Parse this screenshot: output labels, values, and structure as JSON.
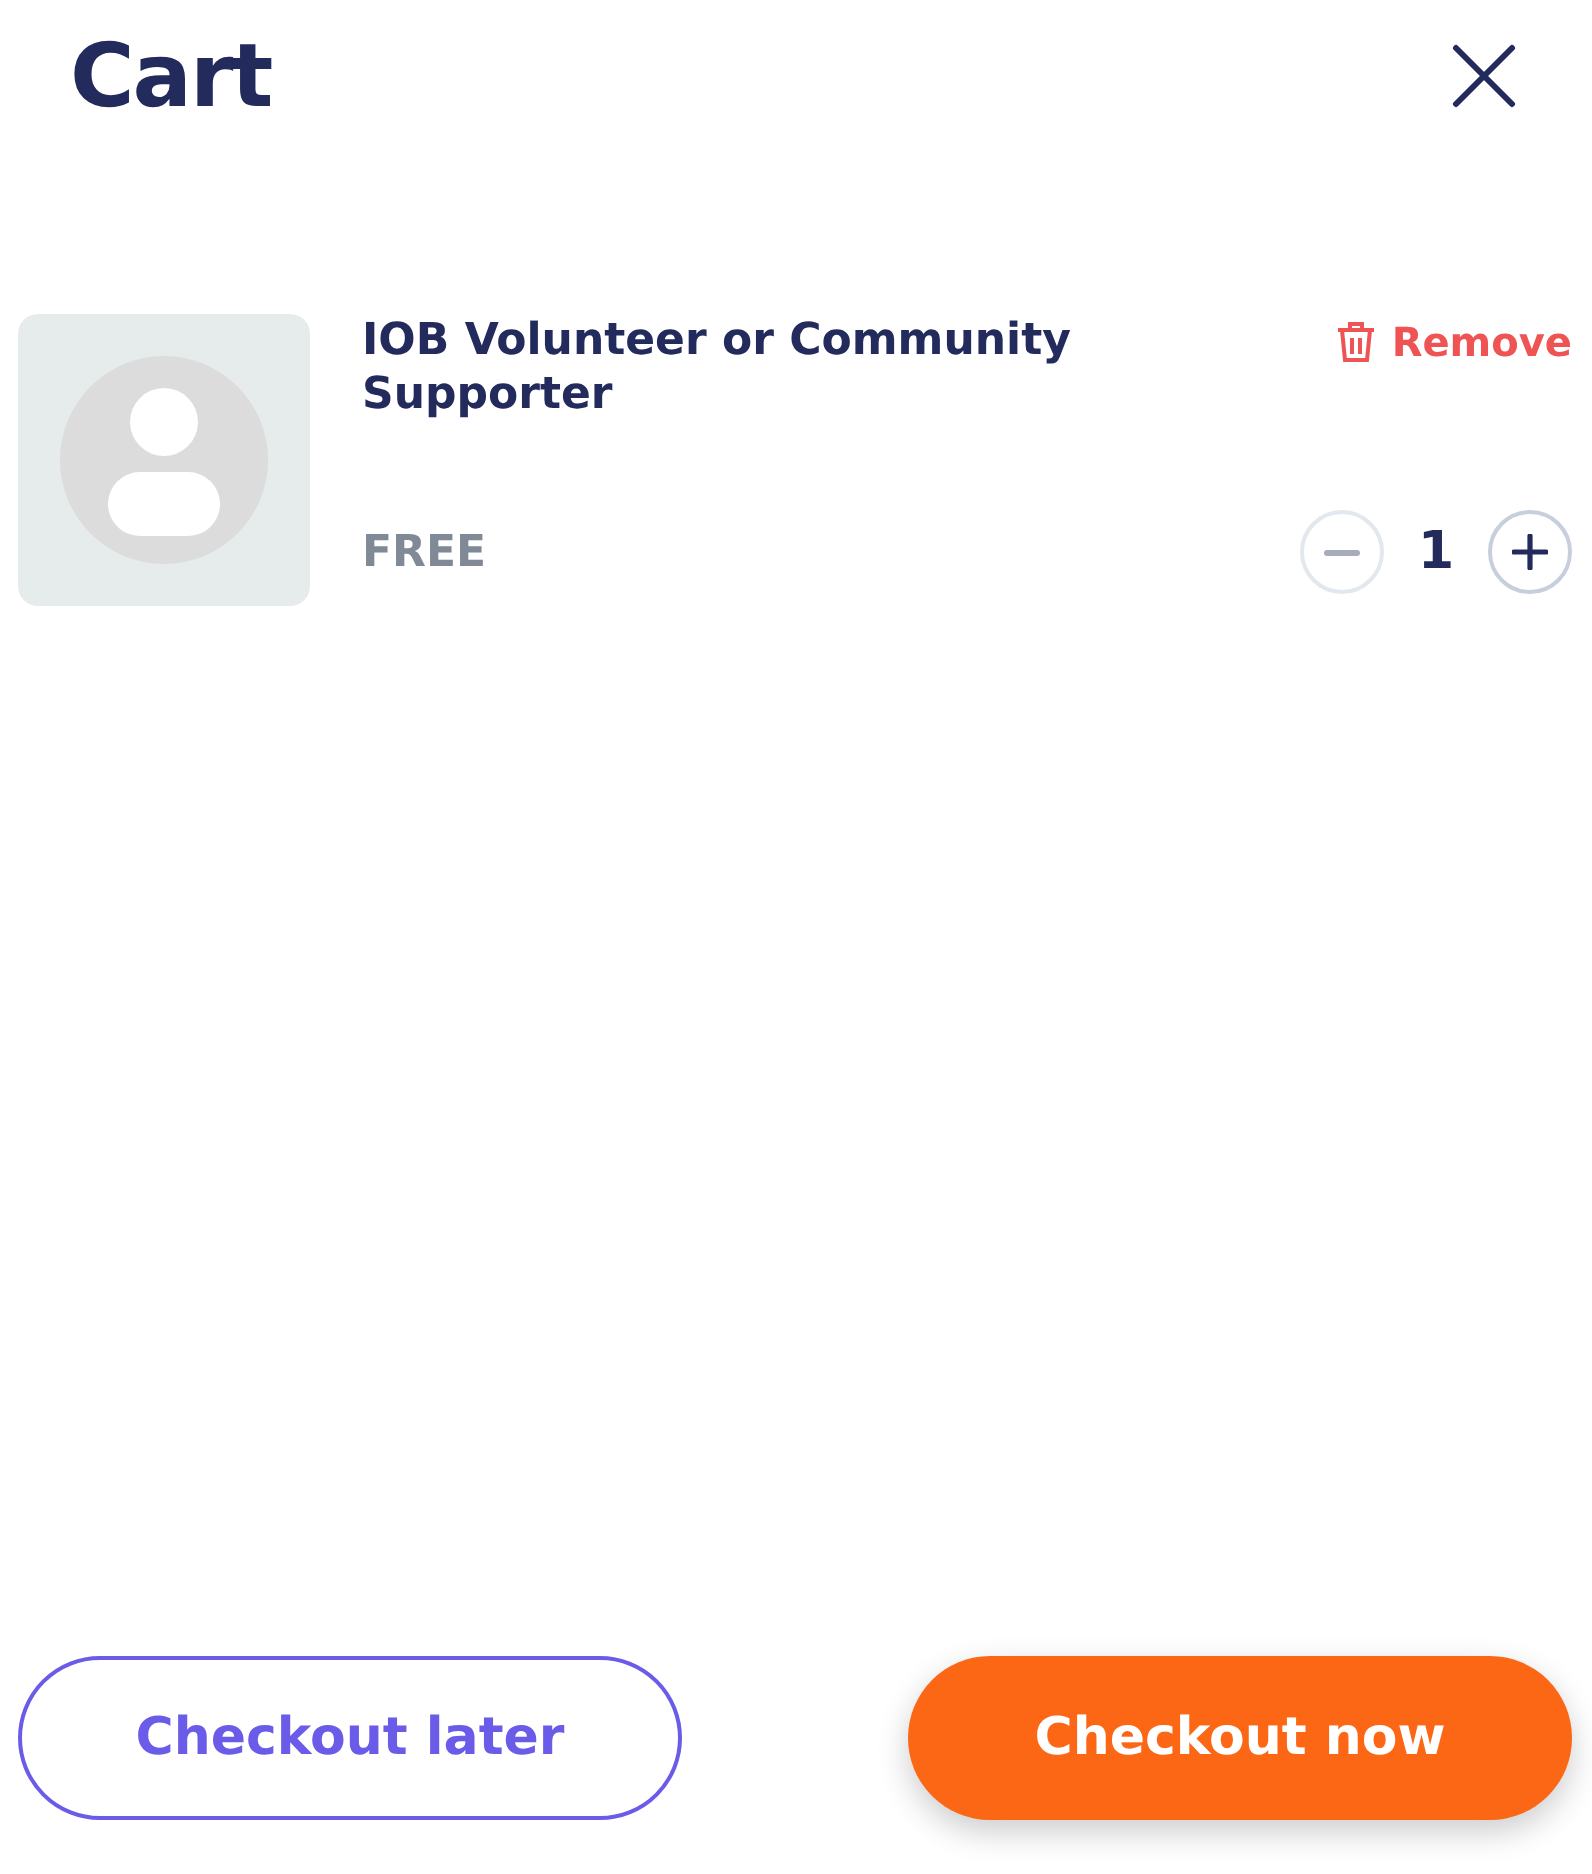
{
  "header": {
    "title": "Cart"
  },
  "items": [
    {
      "name": "IOB Volunteer or Community Supporter",
      "price": "FREE",
      "remove_label": "Remove",
      "quantity": "1",
      "decrease": {
        "disabled": true
      },
      "increase": {
        "disabled": false
      }
    }
  ],
  "footer": {
    "buttons": [
      {
        "label": "Checkout later",
        "kind": "outline"
      },
      {
        "label": "Checkout now",
        "kind": "primary"
      }
    ]
  }
}
